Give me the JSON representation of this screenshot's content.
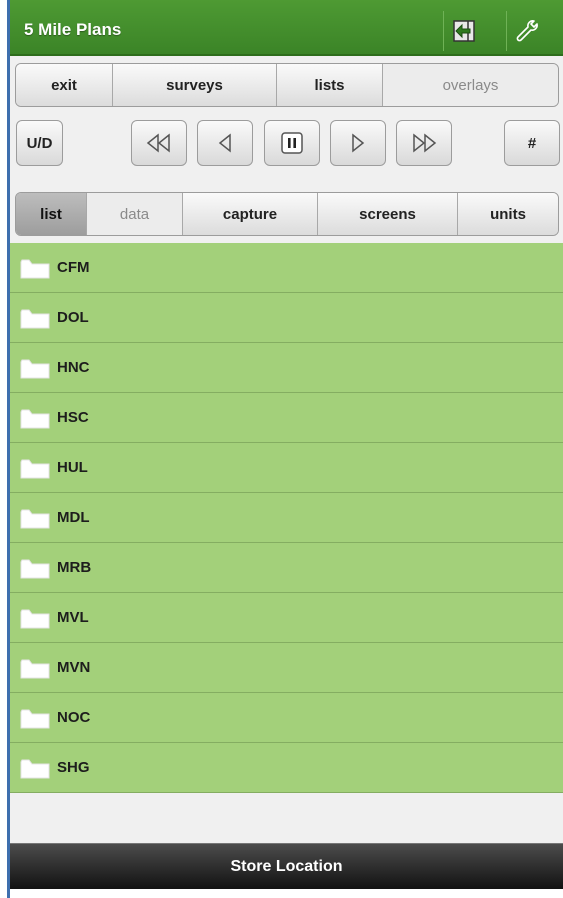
{
  "header": {
    "title": "5 Mile Plans",
    "import_icon": "import-arrow-icon",
    "settings_icon": "wrench-icon"
  },
  "nav": {
    "exit": "exit",
    "surveys": "surveys",
    "lists": "lists",
    "overlays": "overlays"
  },
  "playback": {
    "ud": "U/D",
    "hash": "#",
    "icons": [
      "rewind-icon",
      "step-back-icon",
      "pause-icon",
      "play-icon",
      "fast-forward-icon"
    ]
  },
  "view_tabs": {
    "list": "list",
    "data": "data",
    "capture": "capture",
    "screens": "screens",
    "units": "units"
  },
  "folders": [
    "CFM",
    "DOL",
    "HNC",
    "HSC",
    "HUL",
    "MDL",
    "MRB",
    "MVL",
    "MVN",
    "NOC",
    "SHG"
  ],
  "footer": {
    "store_location": "Store Location"
  },
  "colors": {
    "header_green": "#3f8a2b",
    "row_green": "#a3d07a",
    "footer_dark": "#2b2b2b"
  }
}
